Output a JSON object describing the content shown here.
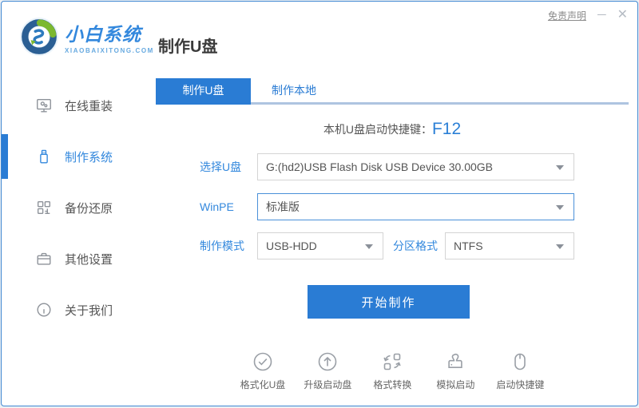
{
  "window": {
    "disclaimer_link": "免责声明",
    "minimize_glyph": "─",
    "close_glyph": "✕"
  },
  "brand": {
    "name": "小白系统",
    "domain": "XIAOBAIXITONG.COM"
  },
  "header": {
    "title": "制作U盘"
  },
  "sidebar": {
    "items": [
      {
        "label": "在线重装",
        "icon": "monitor-gears-icon",
        "active": false
      },
      {
        "label": "制作系统",
        "icon": "usb-drive-icon",
        "active": true
      },
      {
        "label": "备份还原",
        "icon": "backup-grid-icon",
        "active": false
      },
      {
        "label": "其他设置",
        "icon": "briefcase-icon",
        "active": false
      },
      {
        "label": "关于我们",
        "icon": "info-circle-icon",
        "active": false
      }
    ]
  },
  "tabs": [
    {
      "label": "制作U盘",
      "active": true
    },
    {
      "label": "制作本地",
      "active": false
    }
  ],
  "main": {
    "hotkey_label": "本机U盘启动快捷键：",
    "hotkey_value": "F12",
    "fields": {
      "usb": {
        "label": "选择U盘",
        "value": "G:(hd2)USB Flash Disk USB Device 30.00GB"
      },
      "winpe": {
        "label": "WinPE",
        "value": "标准版"
      },
      "mode": {
        "label": "制作模式",
        "value": "USB-HDD"
      },
      "partition": {
        "label": "分区格式",
        "value": "NTFS"
      }
    },
    "start_button": "开始制作"
  },
  "toolbar": {
    "tools": [
      {
        "label": "格式化U盘",
        "icon": "check-circle-icon"
      },
      {
        "label": "升级启动盘",
        "icon": "arrow-up-circle-icon"
      },
      {
        "label": "格式转换",
        "icon": "convert-icon"
      },
      {
        "label": "模拟启动",
        "icon": "stamp-icon"
      },
      {
        "label": "启动快捷键",
        "icon": "mouse-icon"
      }
    ]
  },
  "colors": {
    "brand_blue": "#2a7cd4",
    "accent_blue": "#3388dd",
    "underline_light": "#aec4e0",
    "hotkey_blue": "#2a7fd6",
    "border_gray": "#d4d4d4",
    "focus_border_blue": "#4a90d9",
    "icon_gray": "#9a9fa6",
    "logo_green": "#7cb82f",
    "logo_navy": "#2b5f94"
  }
}
